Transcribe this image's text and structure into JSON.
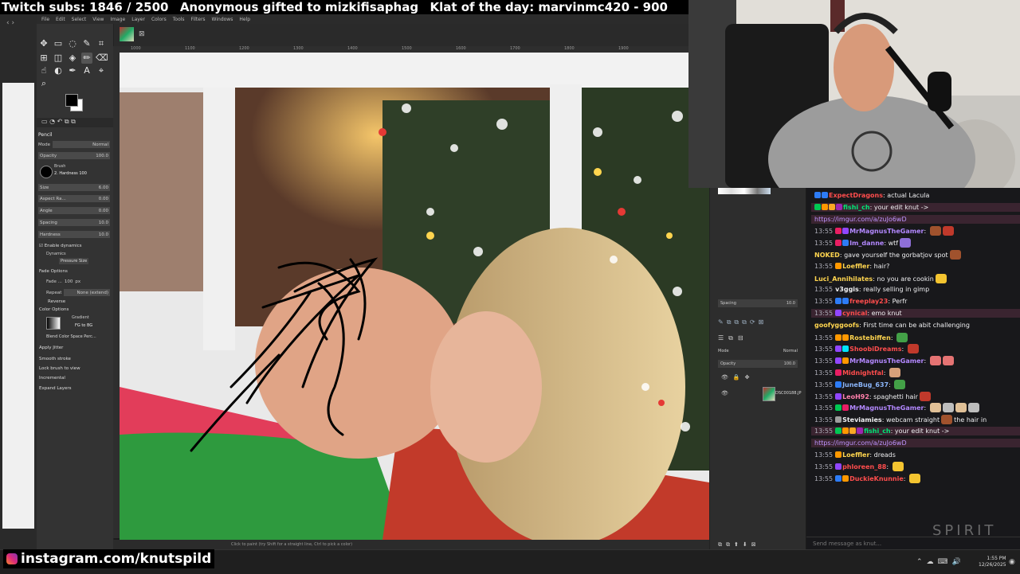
{
  "overlay": {
    "subs_text": "Twitch subs: 1846 / 2500",
    "gift_text": "Anonymous gifted to mizkifisaphag",
    "klat_text": "Klat of the day: marvinmc420 - 900",
    "instagram_text": "instagram.com/knutspild",
    "watermark": "SPIRIT"
  },
  "gimp": {
    "menu": [
      "File",
      "Edit",
      "Select",
      "View",
      "Image",
      "Layer",
      "Colors",
      "Tools",
      "Filters",
      "Windows",
      "Help"
    ],
    "tool_options": {
      "title": "Pencil",
      "mode_label": "Mode",
      "mode_value": "Normal",
      "opacity_label": "Opacity",
      "opacity_value": "100.0",
      "brush_label": "Brush",
      "brush_value": "2. Hardness 100",
      "size_label": "Size",
      "size_value": "6.00",
      "aspect_label": "Aspect Ra...",
      "aspect_value": "0.00",
      "angle_label": "Angle",
      "angle_value": "0.00",
      "spacing_label": "Spacing",
      "spacing_value": "10.0",
      "hardness_label": "Hardness",
      "hardness_value": "10.0",
      "enable_dynamics": "Enable dynamics",
      "dynamics_label": "Dynamics",
      "dynamics_value": "Pressure Size",
      "fade_options": "Fade Options",
      "fade_label": "Fade ...",
      "fade_value": "100",
      "fade_unit": "px",
      "repeat_label": "Repeat",
      "repeat_value": "None (extend)",
      "reverse": "Reverse",
      "color_options": "Color Options",
      "gradient_label": "Gradient",
      "gradient_value": "FG to BG",
      "blend_value": "Blend Color Space Perc...",
      "apply_jitter": "Apply Jitter",
      "smooth_stroke": "Smooth stroke",
      "lock_brush": "Lock brush to view",
      "incremental": "Incremental",
      "expand_layers": "Expand Layers"
    },
    "status_text": "Click to paint (try Shift for a straight line, Ctrl to pick a color)",
    "ruler_ticks": [
      "1000",
      "1100",
      "1200",
      "1300",
      "1400",
      "1500",
      "1600",
      "1700",
      "1800",
      "1900"
    ],
    "brushes_panel": {
      "spacing_label": "Spacing",
      "spacing_value": "10.0"
    },
    "layers_panel": {
      "mode_label": "Mode",
      "mode_value": "Normal",
      "opacity_label": "Opacity",
      "opacity_value": "100.0",
      "layer_name": "DSC00188.JP"
    }
  },
  "chat": {
    "placeholder": "Send message as knut...",
    "messages": [
      {
        "time": "",
        "user": "ExpectDragons",
        "color": "#ff4d4d",
        "text": "actual Lacula",
        "hl": false,
        "badges": [
          "#2d7cf6",
          "#2d7cf6"
        ]
      },
      {
        "time": "",
        "user": "fishi_ch",
        "color": "#00e676",
        "text": "your edit knut ->",
        "hl": true,
        "badges": [
          "#00c853",
          "#ff9800",
          "#f9a825",
          "#9c27b0"
        ]
      },
      {
        "time": "",
        "user": "",
        "color": "",
        "text": "https://imgur.com/a/zuJo6wD",
        "hl": true,
        "link": true,
        "badges": []
      },
      {
        "time": "13:55",
        "user": "MrMagnusTheGamer",
        "color": "#b388ff",
        "text": "",
        "hl": false,
        "badges": [
          "#e91e63",
          "#9146ff"
        ],
        "emotes": [
          "#a0522d",
          "#c0392b"
        ]
      },
      {
        "time": "13:55",
        "user": "Im_danne",
        "color": "#b388ff",
        "text": "wtf",
        "hl": false,
        "badges": [
          "#e91e63",
          "#2d7cf6"
        ],
        "emotes": [
          "#8e6fd8"
        ]
      },
      {
        "time": "",
        "user": "NOKED",
        "color": "#ffd54f",
        "text": "gave yourself the gorbatjov spot",
        "hl": false,
        "badges": [],
        "emotes": [
          "#a0522d"
        ]
      },
      {
        "time": "13:55",
        "user": "Loeffler",
        "color": "#ffd54f",
        "text": "hair?",
        "hl": false,
        "badges": [
          "#ff9800"
        ]
      },
      {
        "time": "",
        "user": "Luci_Annihilates",
        "color": "#ffd54f",
        "text": "no you are cookin",
        "hl": false,
        "badges": [],
        "emotes": [
          "#f4c430"
        ]
      },
      {
        "time": "13:55",
        "user": "v3ggis",
        "color": "#efeff1",
        "text": "really selling in gimp",
        "hl": false,
        "badges": []
      },
      {
        "time": "13:55",
        "user": "freeplay23",
        "color": "#ff4d4d",
        "text": "Perfr",
        "hl": false,
        "badges": [
          "#2d7cf6",
          "#2d7cf6"
        ]
      },
      {
        "time": "13:55",
        "user": "cynical",
        "color": "#ff4d4d",
        "text": "emo knut",
        "hl": true,
        "badges": [
          "#9146ff"
        ]
      },
      {
        "time": "",
        "user": "goofyggoofs",
        "color": "#ffd54f",
        "text": "First time can be abit challenging",
        "hl": false,
        "badges": []
      },
      {
        "time": "13:55",
        "user": "Rostebiffen",
        "color": "#ffd54f",
        "text": "",
        "hl": false,
        "badges": [
          "#ff9800",
          "#ff9800"
        ],
        "emotes": [
          "#43a047"
        ]
      },
      {
        "time": "13:55",
        "user": "ShoobiDreams",
        "color": "#ff4d4d",
        "text": "",
        "hl": false,
        "badges": [
          "#9146ff",
          "#00e5ff"
        ],
        "emotes": [
          "#c0392b"
        ]
      },
      {
        "time": "13:55",
        "user": "MrMagnusTheGamer",
        "color": "#b388ff",
        "text": "",
        "hl": false,
        "badges": [
          "#9146ff",
          "#ff9800"
        ],
        "emotes": [
          "#e57373",
          "#e57373"
        ]
      },
      {
        "time": "13:55",
        "user": "Midnightfal",
        "color": "#ff4d4d",
        "text": "",
        "hl": false,
        "badges": [
          "#e91e63"
        ],
        "emotes": [
          "#d7a07a"
        ]
      },
      {
        "time": "13:55",
        "user": "JuneBug_637",
        "color": "#8ab4f8",
        "text": "",
        "hl": false,
        "badges": [
          "#2d7cf6"
        ],
        "emotes": [
          "#43a047"
        ]
      },
      {
        "time": "13:55",
        "user": "LeoH92",
        "color": "#ff80ab",
        "text": "spaghetti hair",
        "hl": false,
        "badges": [
          "#9146ff"
        ],
        "emotes": [
          "#c0392b"
        ]
      },
      {
        "time": "13:55",
        "user": "MrMagnusTheGamer",
        "color": "#b388ff",
        "text": "",
        "hl": false,
        "badges": [
          "#00c853",
          "#e91e63"
        ],
        "emotes": [
          "#e0c097",
          "#bdbdbd",
          "#e0c097",
          "#bdbdbd"
        ]
      },
      {
        "time": "13:55",
        "user": "Steviamies",
        "color": "#efeff1",
        "text": "webcam straight",
        "text2": "the hair in",
        "hl": false,
        "badges": [
          "#9e9e9e"
        ],
        "emotes": [
          "#a0522d"
        ]
      },
      {
        "time": "13:55",
        "user": "fishi_ch",
        "color": "#00e676",
        "text": "your edit knut ->",
        "hl": true,
        "badges": [
          "#00c853",
          "#ff9800",
          "#f9a825",
          "#9c27b0"
        ]
      },
      {
        "time": "",
        "user": "",
        "color": "",
        "text": "https://imgur.com/a/zuJo6wD",
        "hl": true,
        "link": true,
        "badges": []
      },
      {
        "time": "13:55",
        "user": "Loeffler",
        "color": "#ffd54f",
        "text": "dreads",
        "hl": false,
        "badges": [
          "#ff9800"
        ]
      },
      {
        "time": "13:55",
        "user": "phloreen_88",
        "color": "#ff4d4d",
        "text": "",
        "hl": false,
        "badges": [
          "#9146ff"
        ],
        "emotes": [
          "#f4c430"
        ]
      },
      {
        "time": "13:55",
        "user": "DuckieKnunnie",
        "color": "#ff4d4d",
        "text": "",
        "hl": false,
        "badges": [
          "#2d7cf6",
          "#ff9800"
        ],
        "emotes": [
          "#f4c430"
        ]
      }
    ]
  },
  "taskbar": {
    "time": "1:55 PM",
    "date": "12/26/2025"
  }
}
